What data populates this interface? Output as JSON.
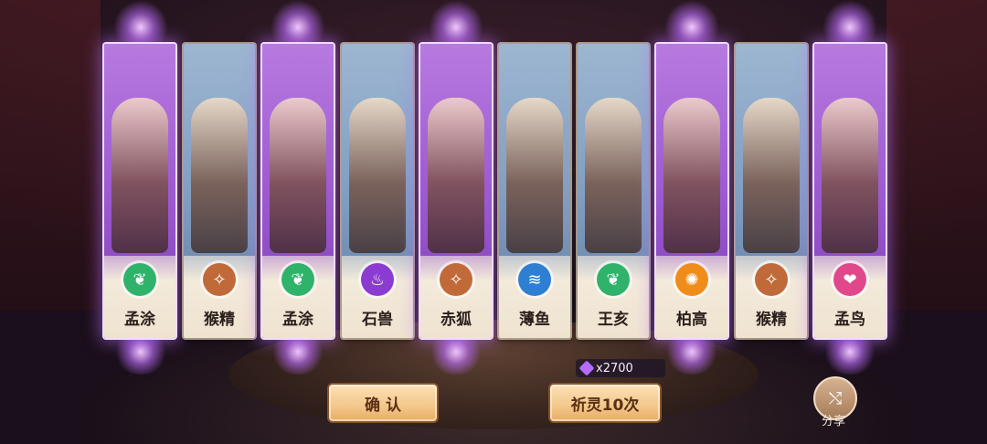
{
  "cards": [
    {
      "name": "孟涂",
      "frame": "purple",
      "element_icon": "leaf-element-icon",
      "element_glyph": "❦",
      "element_color": "#2fb36a"
    },
    {
      "name": "猴精",
      "frame": "blue",
      "element_icon": "spark-element-icon",
      "element_glyph": "✧",
      "element_color": "#c06a3a"
    },
    {
      "name": "孟涂",
      "frame": "purple",
      "element_icon": "leaf-element-icon",
      "element_glyph": "❦",
      "element_color": "#2fb36a"
    },
    {
      "name": "石兽",
      "frame": "blue",
      "element_icon": "flame-element-icon",
      "element_glyph": "♨",
      "element_color": "#8b3bd1"
    },
    {
      "name": "赤狐",
      "frame": "purple",
      "element_icon": "spark-element-icon",
      "element_glyph": "✧",
      "element_color": "#c06a3a"
    },
    {
      "name": "薄鱼",
      "frame": "blue",
      "element_icon": "water-element-icon",
      "element_glyph": "≋",
      "element_color": "#2e7fd1"
    },
    {
      "name": "王亥",
      "frame": "blue",
      "element_icon": "leaf-element-icon",
      "element_glyph": "❦",
      "element_color": "#2fb36a"
    },
    {
      "name": "柏高",
      "frame": "purple",
      "element_icon": "sun-element-icon",
      "element_glyph": "✺",
      "element_color": "#f08d1a"
    },
    {
      "name": "猴精",
      "frame": "blue",
      "element_icon": "spark-element-icon",
      "element_glyph": "✧",
      "element_color": "#c06a3a"
    },
    {
      "name": "孟鸟",
      "frame": "purple",
      "element_icon": "heart-element-icon",
      "element_glyph": "❤",
      "element_color": "#e0488b"
    }
  ],
  "currency": {
    "icon": "purple-gem-icon",
    "amount": "x2700"
  },
  "buttons": {
    "confirm": "确 认",
    "summon_ten": "祈灵10次"
  },
  "share": {
    "icon": "share-icon",
    "label": "分享"
  }
}
